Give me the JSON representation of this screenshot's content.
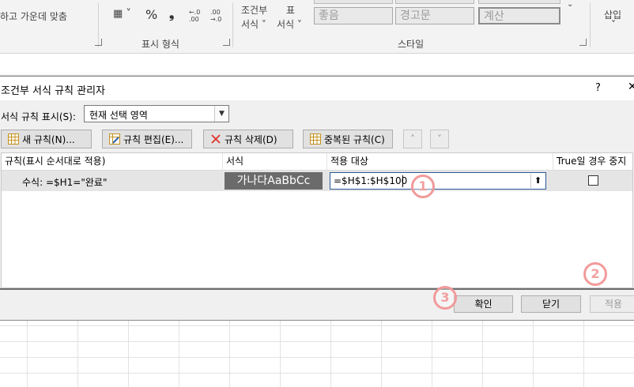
{
  "ribbon": {
    "align_partial": "하고 가운데 맞춤",
    "percent_symbol": "%",
    "comma_symbol": "❟",
    "decimal_increase": "←.0 .00",
    "decimal_decrease": ".00 →.0",
    "conditional_format_line1": "조건부",
    "conditional_format_line2": "서식 ˅",
    "table_format_line1": "표",
    "table_format_line2": "서식 ˅",
    "number_group_label": "표시 형식",
    "styles_group_label": "스타일",
    "style_good": "좋음",
    "style_warning": "경고문",
    "style_calc": "계산",
    "insert_label": "삽입",
    "insert_arrow": "˅"
  },
  "dialog": {
    "title": "조건부 서식 규칙 관리자",
    "help": "?",
    "close": "✕",
    "show_rules_label": "서식 규칙 표시(S):",
    "scope_value": "현재 선택 영역",
    "buttons": {
      "new_rule": "새 규칙(N)...",
      "edit_rule": "규칙 편집(E)...",
      "delete_rule": "규칙 삭제(D)",
      "duplicate_rule": "중복된 규칙(C)",
      "move_up": "˄",
      "move_down": "˅"
    },
    "columns": {
      "rule": "규칙(표시 순서대로 적용)",
      "format": "서식",
      "applies_to": "적용 대상",
      "stop_if_true": "True일 경우 중지"
    },
    "rule_row": {
      "rule": "수식: =$H1=\"완료\"",
      "preview": "가나다AaBbCc",
      "applies_to": "=$H$1:$H$100",
      "stop_if_true": false
    },
    "footer": {
      "ok": "확인",
      "close": "닫기",
      "apply": "적용"
    }
  },
  "annotations": {
    "one": "1",
    "two": "2",
    "three": "3"
  },
  "colors": {
    "annotation": "#f29a9a",
    "preview_bg": "#6b6b6b",
    "delete_icon": "#e0322b"
  }
}
